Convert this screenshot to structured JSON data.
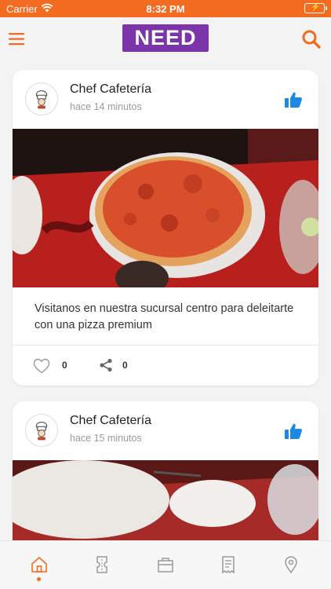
{
  "status_bar": {
    "carrier": "Carrier",
    "time": "8:32 PM"
  },
  "header": {
    "logo_text": "NEED",
    "menu_icon": "hamburger-menu-icon",
    "search_icon": "search-icon"
  },
  "colors": {
    "accent": "#f26b21",
    "logo_bg": "#7b35a8",
    "like_blue": "#1e88e5"
  },
  "posts": [
    {
      "author": "Chef Cafetería",
      "time_ago": "hace 14 minutos",
      "caption": "Visitanos en nuestra sucursal centro para deleitarte con una pizza premium",
      "likes": "0",
      "shares": "0"
    },
    {
      "author": "Chef Cafetería",
      "time_ago": "hace 15 minutos"
    }
  ],
  "tab_bar": {
    "active": "home",
    "tabs": [
      "home-icon",
      "coupon-icon",
      "store-icon",
      "receipt-icon",
      "location-pin-icon"
    ]
  }
}
